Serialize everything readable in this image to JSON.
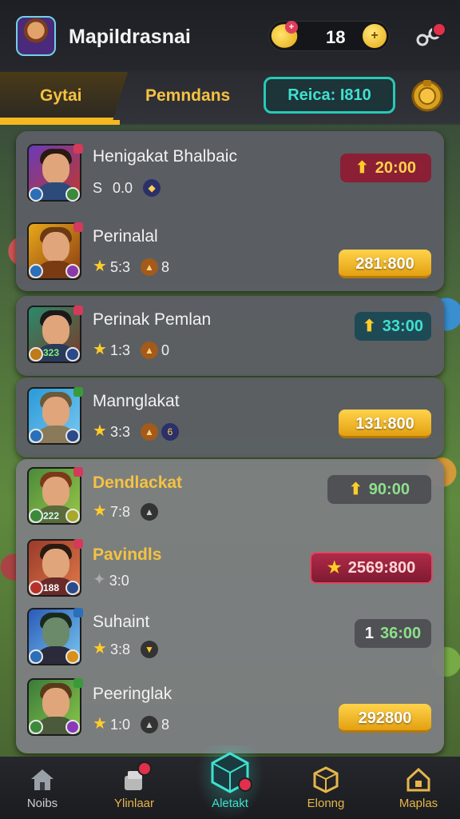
{
  "header": {
    "player_name": "Mapildrasnai",
    "currency_value": "18",
    "currency_plus": "+",
    "coin_symbol": "+"
  },
  "tabs": {
    "tab1": "Gytai",
    "tab2": "Pemndans",
    "tab3": "Reica: I810"
  },
  "rows": [
    {
      "name": "Henigakat Bhalbaic",
      "stats_a": "S",
      "stats_b": "0.0",
      "reward": "20:00",
      "reward_style": "red"
    },
    {
      "name": "Perinalal",
      "stats_a": "5:3",
      "stats_b": "8",
      "reward": "281:800",
      "reward_style": "gold"
    },
    {
      "name": "Perinak Pemlan",
      "stats_a": "1:3",
      "stats_b": "0",
      "reward": "33:00",
      "reward_style": "teal"
    },
    {
      "name": "Mannglakat",
      "stats_a": "3:3",
      "stats_b": "6",
      "reward": "131:800",
      "reward_style": "gold"
    },
    {
      "name": "Dendlackat",
      "stats_a": "7:8",
      "stats_b": "",
      "reward": "90:00",
      "reward_style": "gray"
    },
    {
      "name": "Pavindls",
      "stats_a": "3:0",
      "stats_b": "",
      "reward": "2569:800",
      "reward_style": "bigred"
    },
    {
      "name": "Suhaint",
      "stats_a": "3:8",
      "stats_b": "",
      "reward": "36:00",
      "reward_prefix": "1",
      "reward_style": "gray"
    },
    {
      "name": "Peeringlak",
      "stats_a": "1:0",
      "stats_b": "8",
      "reward": "292800",
      "reward_style": "gold"
    }
  ],
  "portrait_numbers": {
    "row3": "323",
    "row5": "222",
    "row6": "188"
  },
  "nav": {
    "item1": "Noibs",
    "item2": "Ylinlaar",
    "item3": "Aletakt",
    "item4": "Elonng",
    "item5": "Maplas"
  },
  "colors": {
    "accent_gold": "#f5c242",
    "accent_teal": "#3fe0d0",
    "reward_red": "#8a1f35"
  }
}
